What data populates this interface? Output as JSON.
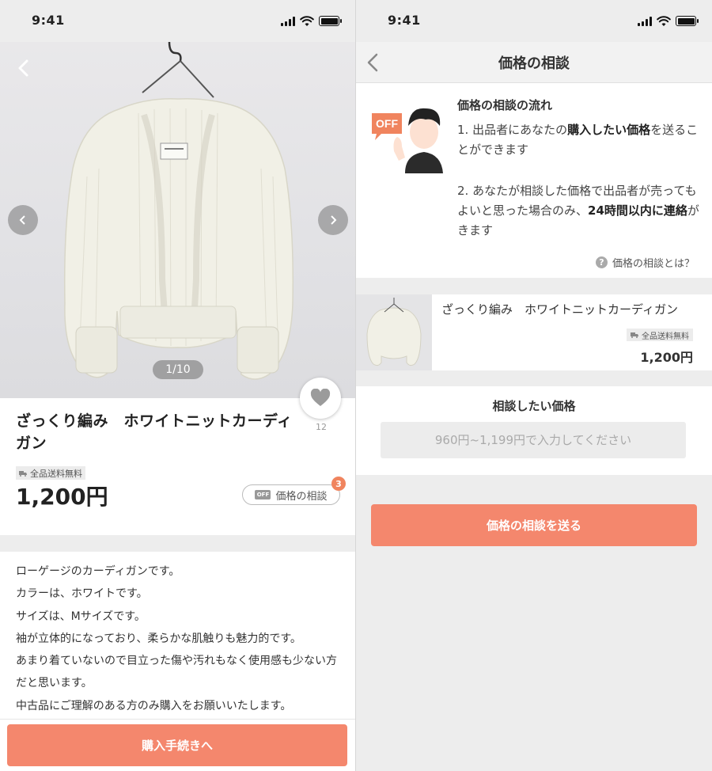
{
  "status_bar": {
    "time": "9:41"
  },
  "product": {
    "image_counter": "1/10",
    "like_count": "12",
    "title": "ざっくり編み　ホワイトニットカーディガン",
    "shipping_badge": "全品送料無料",
    "price": "1,200円",
    "offer_button_label": "価格の相談",
    "offer_button_icon_text": "OFF",
    "offer_count": "3",
    "description": [
      "ローゲージのカーディガンです。",
      "カラーは、ホワイトです。",
      "サイズは、Mサイズです。",
      "袖が立体的になっており、柔らかな肌触りも魅力的です。",
      "あまり着ていないので目立った傷や汚れもなく使用感も少ない方だと思います。",
      "中古品にご理解のある方のみ購入をお願いいたします。"
    ],
    "buy_button_label": "購入手続きへ",
    "accent_color": "#f4876d"
  },
  "offer_screen": {
    "header_title": "価格の相談",
    "flow": {
      "illustration_text": "OFF",
      "title": "価格の相談の流れ",
      "step1_pre": "1. 出品者にあなたの",
      "step1_bold": "購入したい価格",
      "step1_post": "を送ることができます",
      "step2_pre": "2. あなたが相談した価格で出品者が売ってもよいと思った場合のみ、",
      "step2_bold1": "24時間以内に連絡",
      "step2_post": "がきます",
      "help_link": "価格の相談とは？",
      "help_icon_text": "?"
    },
    "item": {
      "title": "ざっくり編み　ホワイトニットカーディガン",
      "shipping_badge": "全品送料無料",
      "price": "1,200円"
    },
    "price_input": {
      "label": "相談したい価格",
      "placeholder": "960円~1,199円で入力してください",
      "value": ""
    },
    "send_button_label": "価格の相談を送る"
  }
}
